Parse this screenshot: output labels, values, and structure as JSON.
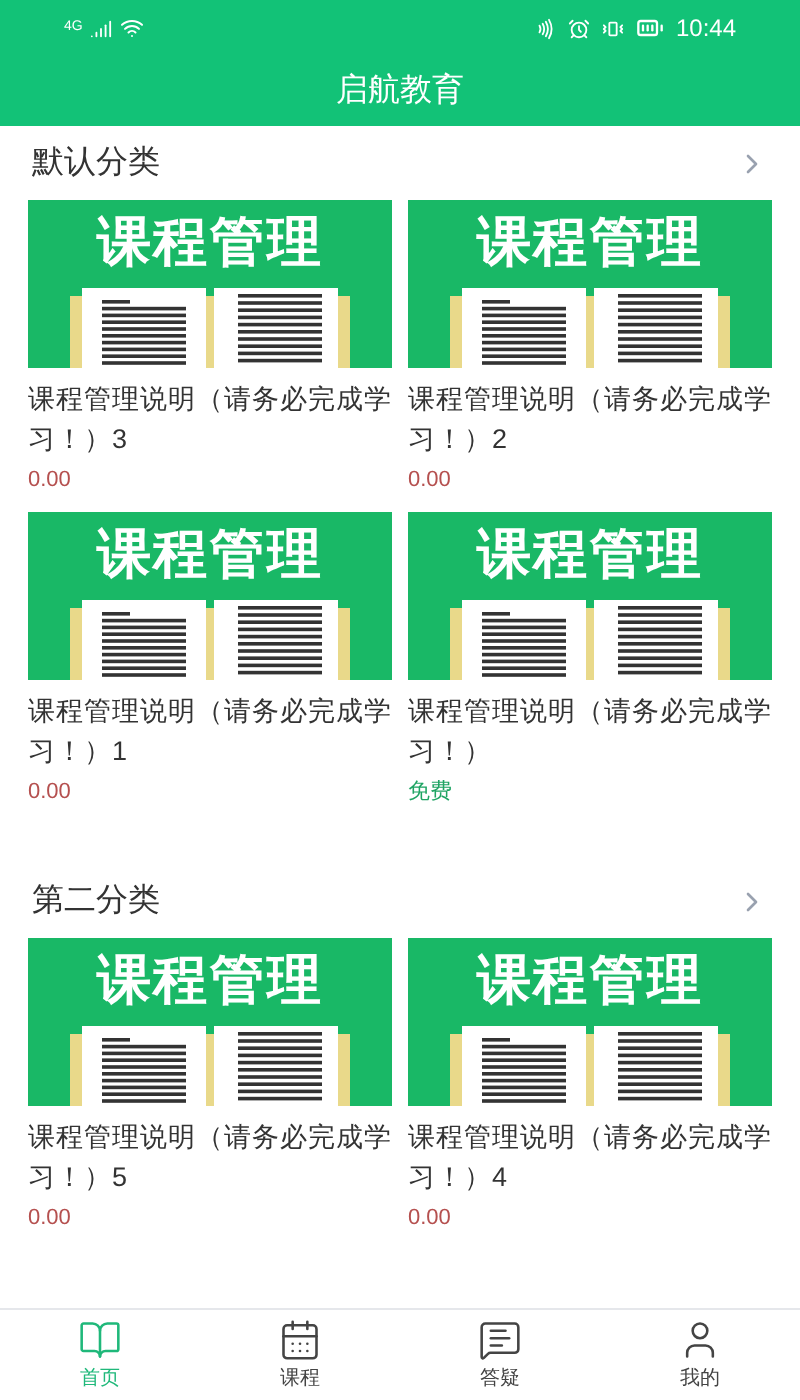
{
  "status_bar": {
    "network": "4G",
    "time": "10:44"
  },
  "header": {
    "title": "启航教育"
  },
  "sections": [
    {
      "title": "默认分类",
      "courses": [
        {
          "banner_text": "课程管理",
          "title": "课程管理说明（请务必完成学习！）3",
          "price": "0.00",
          "kind": "paid"
        },
        {
          "banner_text": "课程管理",
          "title": "课程管理说明（请务必完成学习！）2",
          "price": "0.00",
          "kind": "paid"
        },
        {
          "banner_text": "课程管理",
          "title": "课程管理说明（请务必完成学习！）1",
          "price": "0.00",
          "kind": "paid"
        },
        {
          "banner_text": "课程管理",
          "title": "课程管理说明（请务必完成学习！）",
          "price": "免费",
          "kind": "free"
        }
      ]
    },
    {
      "title": "第二分类",
      "courses": [
        {
          "banner_text": "课程管理",
          "title": "课程管理说明（请务必完成学习！）5",
          "price": "0.00",
          "kind": "paid"
        },
        {
          "banner_text": "课程管理",
          "title": "课程管理说明（请务必完成学习！）4",
          "price": "0.00",
          "kind": "paid"
        }
      ]
    }
  ],
  "tab_bar": [
    {
      "label": "首页",
      "selected": true
    },
    {
      "label": "课程",
      "selected": false
    },
    {
      "label": "答疑",
      "selected": false
    },
    {
      "label": "我的",
      "selected": false
    }
  ]
}
